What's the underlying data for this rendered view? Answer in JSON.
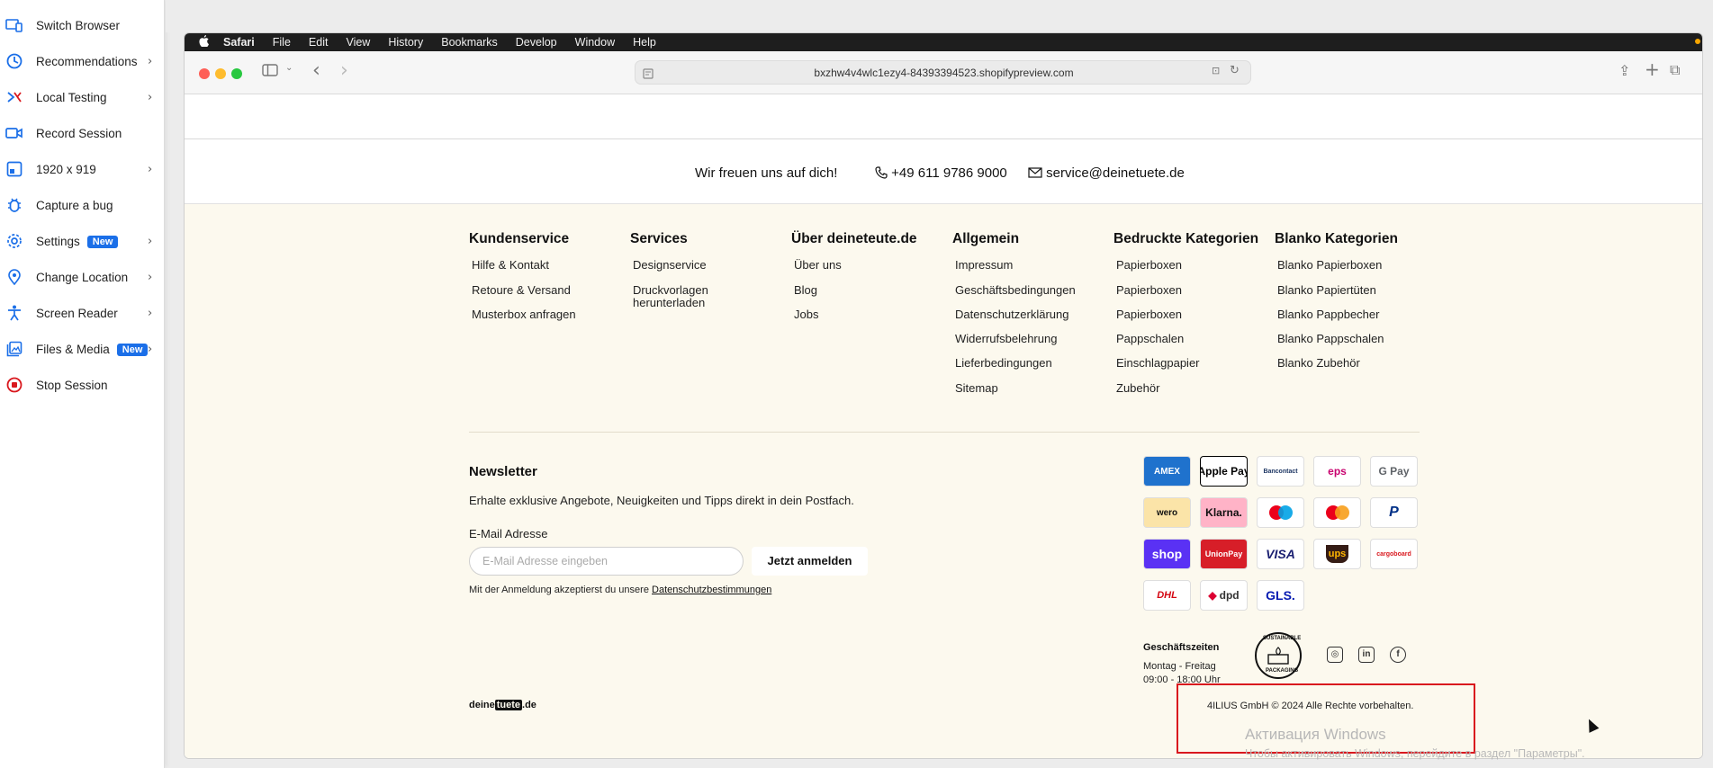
{
  "panel": {
    "items": [
      {
        "label": "Switch Browser",
        "icon": "switch-browser-icon",
        "chevron": false,
        "badge": ""
      },
      {
        "label": "Recommendations",
        "icon": "recommendations-icon",
        "chevron": true,
        "badge": ""
      },
      {
        "label": "Local Testing",
        "icon": "local-testing-icon",
        "chevron": true,
        "badge": ""
      },
      {
        "label": "Record Session",
        "icon": "record-session-icon",
        "chevron": false,
        "badge": ""
      },
      {
        "label": "1920 x 919",
        "icon": "resolution-icon",
        "chevron": true,
        "badge": ""
      },
      {
        "label": "Capture a bug",
        "icon": "bug-icon",
        "chevron": false,
        "badge": ""
      },
      {
        "label": "Settings",
        "icon": "gear-icon",
        "chevron": true,
        "badge": "New"
      },
      {
        "label": "Change Location",
        "icon": "location-pin-icon",
        "chevron": true,
        "badge": ""
      },
      {
        "label": "Screen Reader",
        "icon": "accessibility-icon",
        "chevron": true,
        "badge": ""
      },
      {
        "label": "Files & Media",
        "icon": "files-media-icon",
        "chevron": true,
        "badge": "New"
      },
      {
        "label": "Stop Session",
        "icon": "stop-icon",
        "chevron": false,
        "badge": ""
      }
    ],
    "chevron_glyph": "›",
    "accent": "#1b6fe8",
    "stop_color": "#d9181e"
  },
  "menubar": {
    "apple": "",
    "items": [
      "Safari",
      "File",
      "Edit",
      "View",
      "History",
      "Bookmarks",
      "Develop",
      "Window",
      "Help"
    ]
  },
  "toolbar": {
    "url": "bxzhw4v4wlc1ezy4-84393394523.shopifypreview.com",
    "back": "‹",
    "forward": "›",
    "share": "⇪",
    "new_tab": "+",
    "tabs": "⧉"
  },
  "contact": {
    "greeting": "Wir freuen uns auf dich!",
    "phone": "+49 611 9786 9000",
    "email": "service@deinetuete.de"
  },
  "footer": {
    "columns": [
      {
        "heading": "Kundenservice",
        "links": [
          "Hilfe & Kontakt",
          "Retoure & Versand",
          "Musterbox anfragen"
        ]
      },
      {
        "heading": "Services",
        "links": [
          "Designservice",
          "Druckvorlagen",
          "herunterladen"
        ]
      },
      {
        "heading": "Über deineteute.de",
        "links": [
          "Über uns",
          "Blog",
          "Jobs"
        ]
      },
      {
        "heading": "Allgemein",
        "links": [
          "Impressum",
          "Geschäftsbedingungen",
          "Datenschutzerklärung",
          "Widerrufsbelehrung",
          "Lieferbedingungen",
          "Sitemap"
        ]
      },
      {
        "heading": "Bedruckte Kategorien",
        "links": [
          "Papierboxen",
          "Papierboxen",
          "Papierboxen",
          "Pappschalen",
          "Einschlagpapier",
          "Zubehör"
        ]
      },
      {
        "heading": "Blanko Kategorien",
        "links": [
          "Blanko Papierboxen",
          "Blanko Papiertüten",
          "Blanko Pappbecher",
          "Blanko Pappschalen",
          "Blanko Zubehör"
        ]
      }
    ],
    "newsletter": {
      "heading": "Newsletter",
      "subtitle": "Erhalte exklusive Angebote, Neuigkeiten und Tipps direkt in dein Postfach.",
      "label": "E-Mail Adresse",
      "placeholder": "E-Mail Adresse eingeben",
      "button": "Jetzt anmelden",
      "consent_text": "Mit der Anmeldung akzeptierst du unsere ",
      "consent_link": "Datenschutzbestimmungen"
    },
    "payments": [
      "AMEX",
      "Apple Pay",
      "Bancontact",
      "eps",
      "G Pay",
      "wero",
      "Klarna.",
      "Maestro",
      "Mastercard",
      "PayPal",
      "shop",
      "UnionPay",
      "VISA",
      "ups",
      "cargoboard",
      "DHL",
      "dpd",
      "GLS."
    ],
    "hours": {
      "heading": "Geschäftszeiten",
      "days": "Montag - Freitag",
      "time": "09:00 - 18:00 Uhr"
    },
    "badge": {
      "top": "SUSTAINABLE",
      "bottom": "PACKAGING"
    },
    "social": [
      {
        "name": "instagram-icon",
        "glyph": "◎"
      },
      {
        "name": "linkedin-icon",
        "glyph": "in"
      },
      {
        "name": "facebook-icon",
        "glyph": "f"
      }
    ],
    "logo": {
      "pre": "deine",
      "mid": "tuete",
      "post": ".de"
    },
    "copyright": "4ILIUS GmbH © 2024 Alle Rechte vorbehalten."
  },
  "overlay": {
    "win_activation_title": "Активация Windows",
    "win_activation_sub": "Чтобы активировать Windows, перейдите в раздел \"Параметры\"."
  }
}
